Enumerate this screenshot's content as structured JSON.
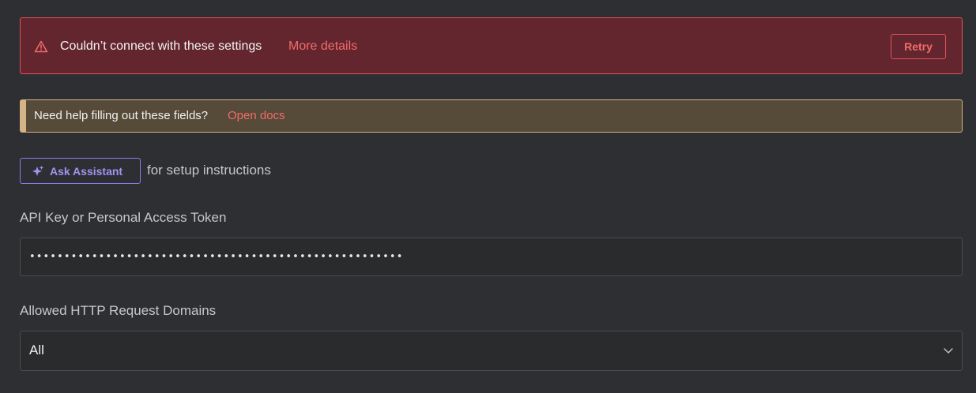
{
  "error_banner": {
    "message": "Couldn’t connect with these settings",
    "details_link": "More details",
    "retry_label": "Retry",
    "icon": "warning-triangle-icon"
  },
  "help_banner": {
    "message": "Need help filling out these fields?",
    "link": "Open docs"
  },
  "assistant": {
    "button_label": "Ask Assistant",
    "suffix": "for setup instructions",
    "icon": "sparkle-icon"
  },
  "api_key": {
    "label": "API Key or Personal Access Token",
    "value": "••••••••••••••••••••••••••••••••••••••••••••••••••••••"
  },
  "domains": {
    "label": "Allowed HTTP Request Domains",
    "selected": "All",
    "icon": "chevron-down-icon"
  },
  "colors": {
    "background": "#2e2f32",
    "error_bg": "#63262e",
    "error_border": "#e2515f",
    "link": "#f36b6b",
    "help_bg": "#564a38",
    "help_accent": "#d4b386",
    "assistant_accent": "#8f7be8"
  }
}
